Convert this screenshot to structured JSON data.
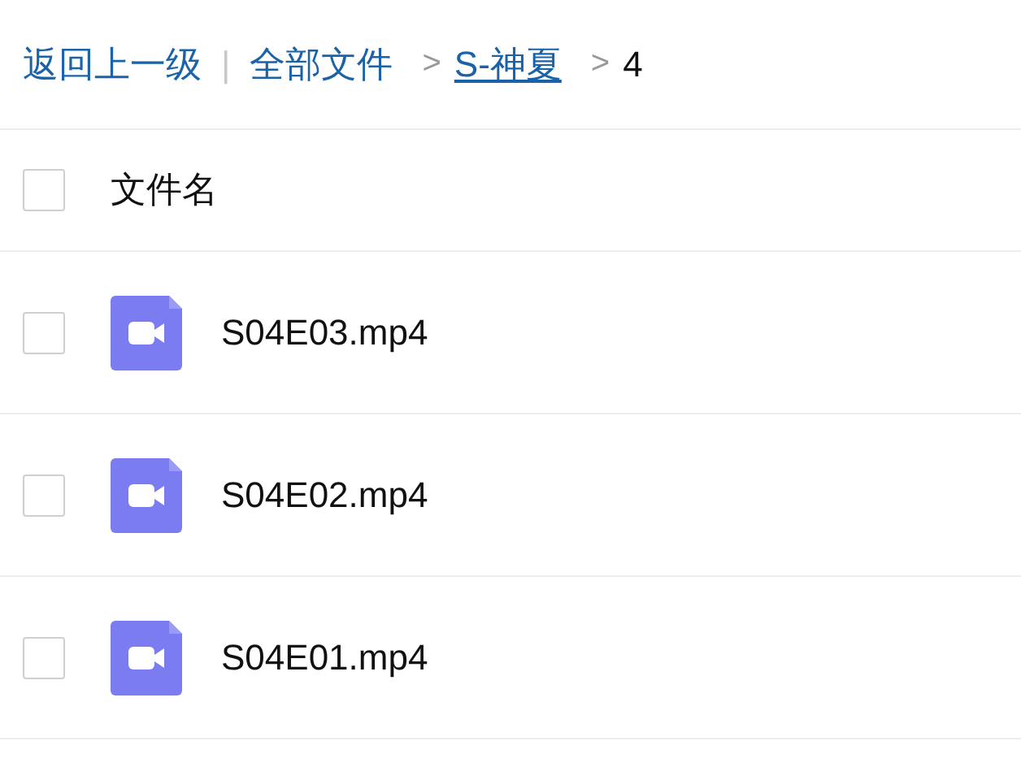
{
  "breadcrumb": {
    "back": "返回上一级",
    "divider": "|",
    "items": [
      {
        "label": "全部文件",
        "kind": "link",
        "underlined": false
      },
      {
        "label": "S-神夏",
        "kind": "link",
        "underlined": true
      },
      {
        "label": "4",
        "kind": "current"
      }
    ],
    "separator": ">"
  },
  "table": {
    "header": {
      "label": "文件名",
      "checked": false
    },
    "rows": [
      {
        "name": "S04E03.mp4",
        "kind": "video",
        "checked": false
      },
      {
        "name": "S04E02.mp4",
        "kind": "video",
        "checked": false
      },
      {
        "name": "S04E01.mp4",
        "kind": "video",
        "checked": false
      }
    ]
  }
}
